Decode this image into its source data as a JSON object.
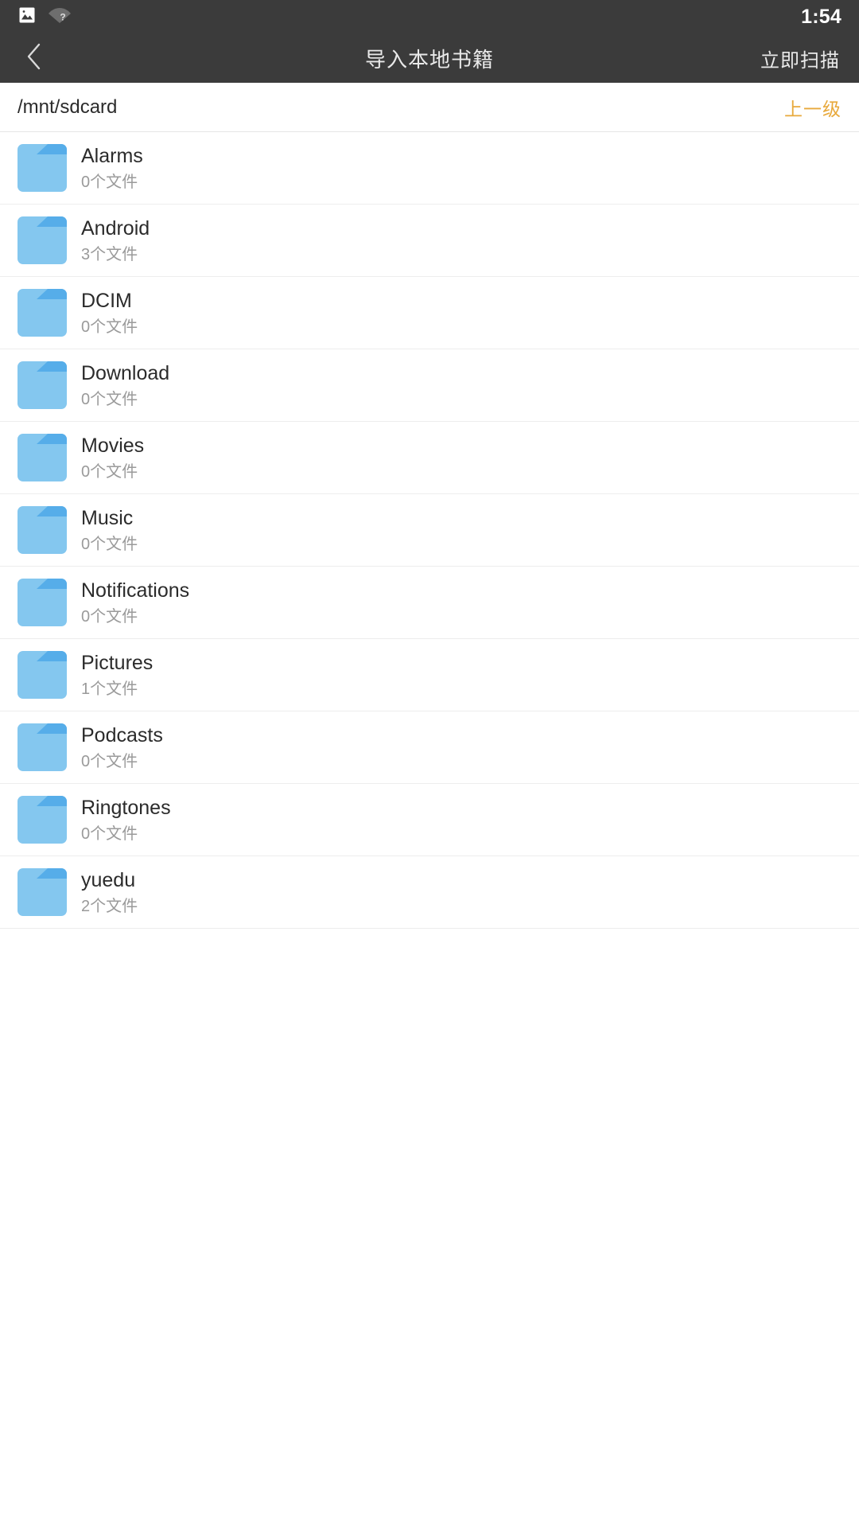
{
  "statusbar": {
    "icons": [
      {
        "name": "image-icon",
        "glyph": "image"
      },
      {
        "name": "wifi-unknown-icon",
        "glyph": "wifi-question"
      }
    ],
    "time": "1:54"
  },
  "appbar": {
    "back_icon": "chevron-left-icon",
    "title": "导入本地书籍",
    "action_label": "立即扫描",
    "background": "#3b3b3b",
    "text_color": "#e9e9e9"
  },
  "pathbar": {
    "path": "/mnt/sdcard",
    "up_label": "上一级",
    "up_color": "#e8a93c"
  },
  "filelist": {
    "icon_name": "folder-icon",
    "folder_color": "#84c7ef",
    "folder_tab_color": "#56ade9",
    "items": [
      {
        "name": "Alarms",
        "sub": "0个文件"
      },
      {
        "name": "Android",
        "sub": "3个文件"
      },
      {
        "name": "DCIM",
        "sub": "0个文件"
      },
      {
        "name": "Download",
        "sub": "0个文件"
      },
      {
        "name": "Movies",
        "sub": "0个文件"
      },
      {
        "name": "Music",
        "sub": "0个文件"
      },
      {
        "name": "Notifications",
        "sub": "0个文件"
      },
      {
        "name": "Pictures",
        "sub": "1个文件"
      },
      {
        "name": "Podcasts",
        "sub": "0个文件"
      },
      {
        "name": "Ringtones",
        "sub": "0个文件"
      },
      {
        "name": "yuedu",
        "sub": "2个文件"
      }
    ]
  }
}
